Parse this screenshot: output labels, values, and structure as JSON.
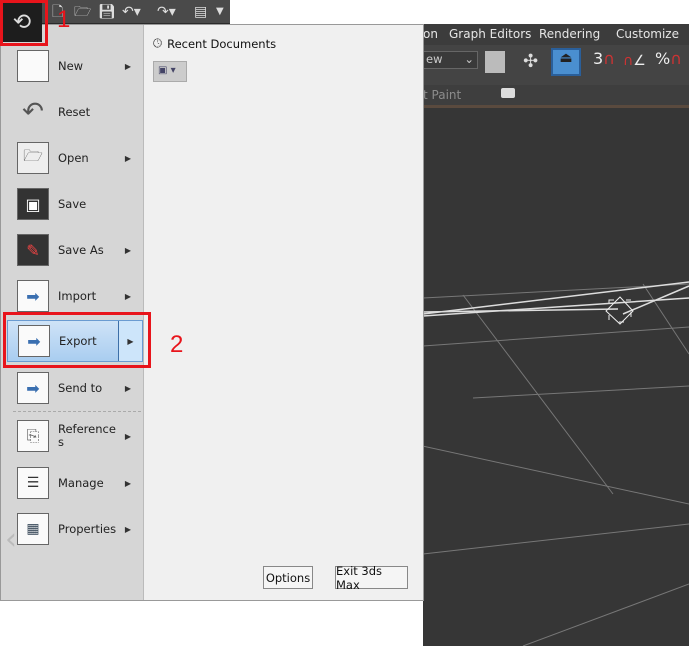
{
  "quick_access": {
    "app_icon": "3ds-max-logo-icon",
    "icons": [
      "new-file-icon",
      "open-folder-icon",
      "save-icon",
      "undo-icon",
      "redo-icon",
      "project-folder-icon",
      "customize-dropdown-icon"
    ]
  },
  "menubar": {
    "items": [
      "on",
      "Graph Editors",
      "Rendering",
      "Customize"
    ]
  },
  "toolbar": {
    "view_select": "ew",
    "snap_label": "3",
    "percent_label": "%"
  },
  "ribbon": {
    "label": "t Paint"
  },
  "app_menu": {
    "recent_title": "Recent Documents",
    "items": [
      {
        "label": "New",
        "icon": "new-icon",
        "submenu": true
      },
      {
        "label": "Reset",
        "icon": "reset-icon",
        "submenu": false
      },
      {
        "label": "Open",
        "icon": "open-icon",
        "submenu": true
      },
      {
        "label": "Save",
        "icon": "save-icon",
        "submenu": false
      },
      {
        "label": "Save As",
        "icon": "save-as-icon",
        "submenu": true
      },
      {
        "label": "Import",
        "icon": "import-icon",
        "submenu": true
      },
      {
        "label": "Export",
        "icon": "export-icon",
        "submenu": true,
        "selected": true
      },
      {
        "label": "Send to",
        "icon": "send-to-icon",
        "submenu": true
      },
      {
        "label": "Reference\ns",
        "icon": "references-icon",
        "submenu": true
      },
      {
        "label": "Manage",
        "icon": "manage-icon",
        "submenu": true
      },
      {
        "label": "Properties",
        "icon": "properties-icon",
        "submenu": true
      }
    ],
    "options_label": "Options",
    "exit_label": "Exit 3ds Max"
  },
  "annotations": {
    "one": "1",
    "two": "2",
    "color": "#e8141b"
  }
}
